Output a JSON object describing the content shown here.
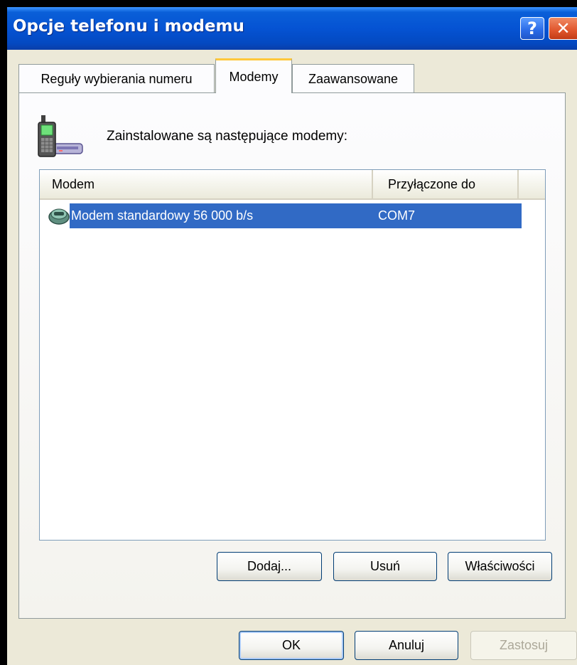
{
  "window": {
    "title": "Opcje telefonu i modemu",
    "help_label": "?",
    "close_label": "✕"
  },
  "tabs": [
    {
      "label": "Reguły wybierania numeru",
      "active": false
    },
    {
      "label": "Modemy",
      "active": true
    },
    {
      "label": "Zaawansowane",
      "active": false
    }
  ],
  "modems_tab": {
    "intro_text": "Zainstalowane są następujące modemy:",
    "icon": "phone-modem-icon",
    "columns": [
      "Modem",
      "Przyłączone do"
    ],
    "rows": [
      {
        "name": "Modem standardowy 56 000 b/s",
        "port": "COM7",
        "icon": "modem-icon",
        "selected": true
      }
    ],
    "buttons": {
      "add": "Dodaj...",
      "remove": "Usuń",
      "properties": "Właściwości"
    }
  },
  "dialog_buttons": {
    "ok": "OK",
    "cancel": "Anuluj",
    "apply": "Zastosuj"
  },
  "colors": {
    "selection": "#316ac5",
    "titlebar": "#0553d3",
    "active_tab_accent": "#ffc83c"
  }
}
